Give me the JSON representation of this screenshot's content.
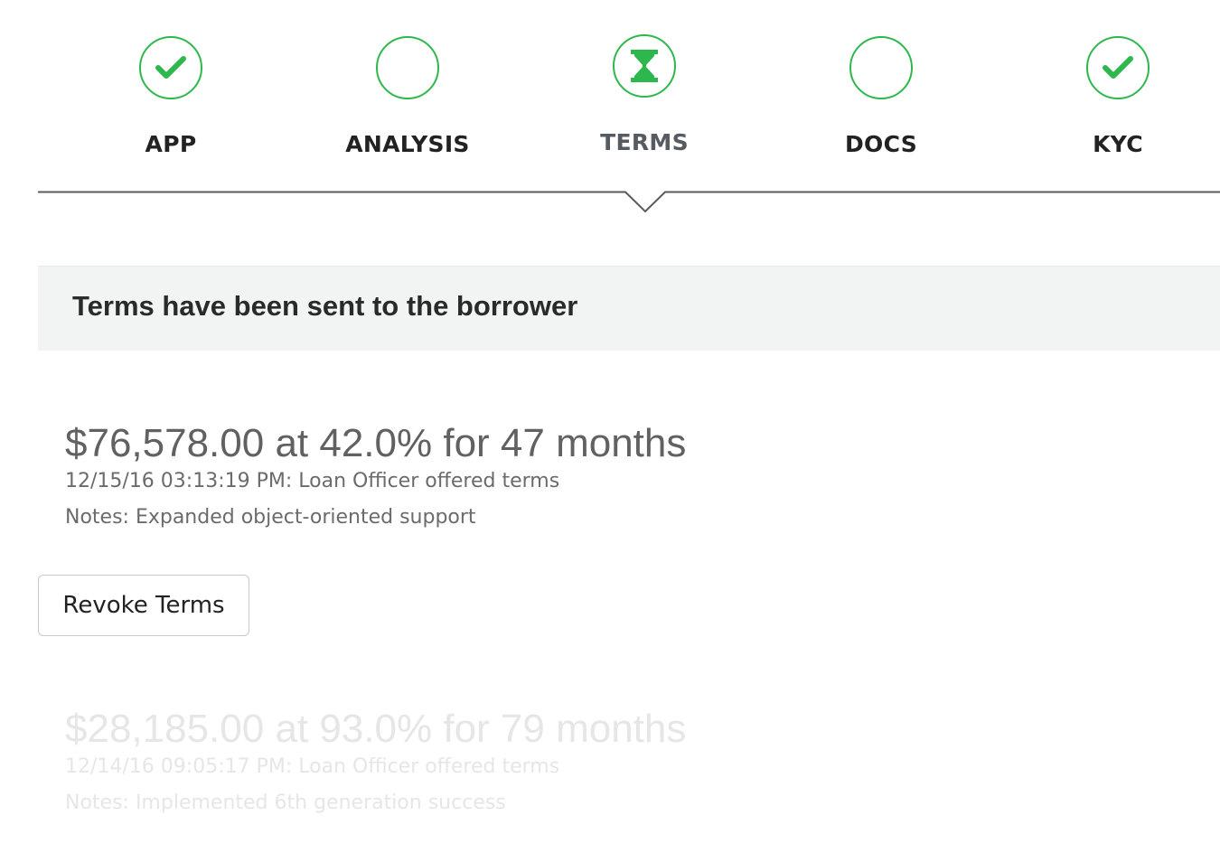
{
  "stepper": {
    "steps": [
      {
        "label": "APP",
        "status": "complete",
        "icon": "check-icon"
      },
      {
        "label": "ANALYSIS",
        "status": "pending",
        "icon": "empty-circle-icon"
      },
      {
        "label": "TERMS",
        "status": "in-progress",
        "icon": "hourglass-icon"
      },
      {
        "label": "DOCS",
        "status": "pending",
        "icon": "empty-circle-icon"
      },
      {
        "label": "KYC",
        "status": "complete",
        "icon": "check-icon"
      }
    ],
    "active_step": "TERMS",
    "accent_color": "#2db84d"
  },
  "banner": {
    "message": "Terms have been sent to the borrower"
  },
  "offers": [
    {
      "title": "$76,578.00 at 42.0% for 47 months",
      "timestamp_line": "12/15/16 03:13:19 PM: Loan Officer offered terms",
      "notes_line": "Notes: Expanded object-oriented support",
      "state": "current"
    },
    {
      "title": "$28,185.00 at 93.0% for 79 months",
      "timestamp_line": "12/14/16 09:05:17 PM: Loan Officer offered terms",
      "notes_line": "Notes: Implemented 6th generation success",
      "state": "superseded"
    }
  ],
  "actions": {
    "revoke_label": "Revoke Terms"
  }
}
